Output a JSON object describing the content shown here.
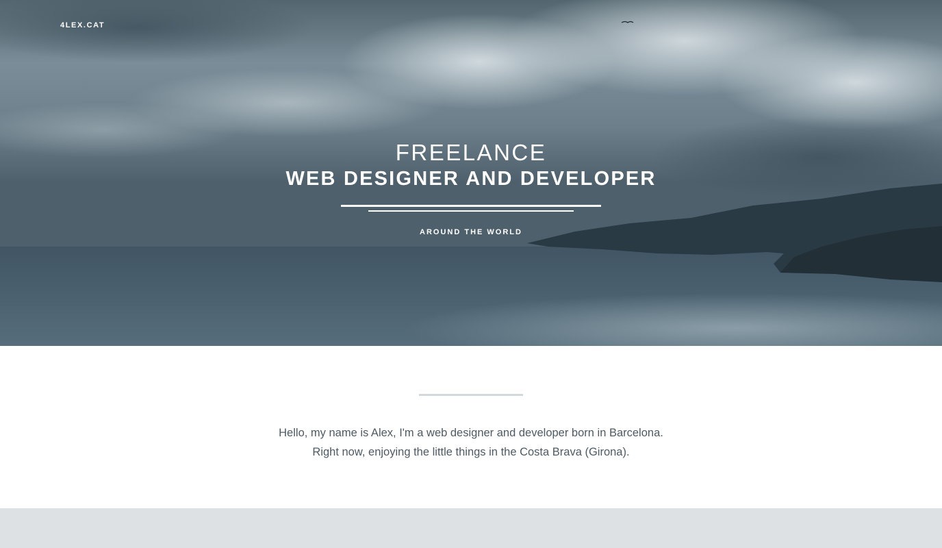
{
  "header": {
    "logo": "4LEX.CAT"
  },
  "hero": {
    "line1": "FREELANCE",
    "line2": "WEB DESIGNER AND DEVELOPER",
    "subtitle": "AROUND THE WORLD"
  },
  "intro": {
    "line1": "Hello, my name is Alex, I'm a web designer and developer born in Barcelona.",
    "line2": "Right now, enjoying the little things in the Costa Brava (Girona)."
  },
  "colors": {
    "hero_tint": "#5c6f7c",
    "text_white": "#ffffff",
    "body_text": "#4e5a63",
    "divider": "#d3d8db",
    "footer_band": "#dde1e3"
  }
}
